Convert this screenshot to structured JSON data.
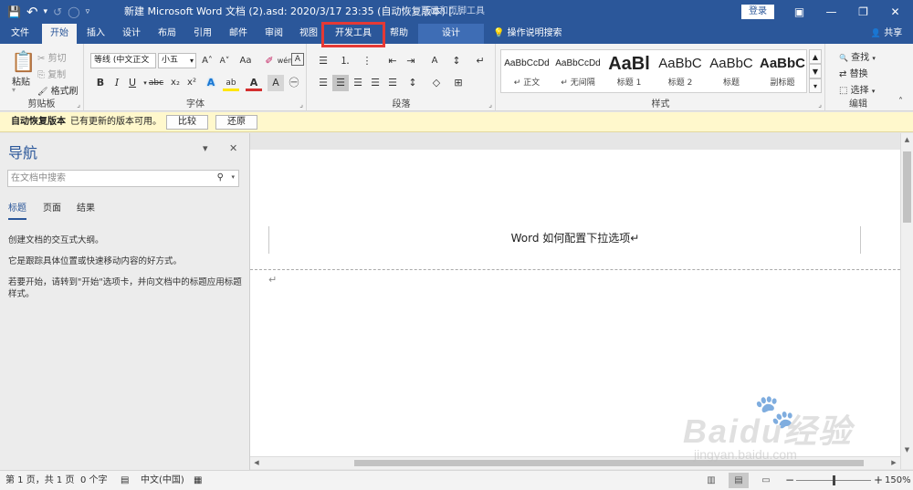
{
  "titlebar": {
    "save_icon": "💾",
    "undo_icon": "↶",
    "undo_dd": "▾",
    "redo_icon": "↺",
    "autosave_icon": "◯",
    "customize_icon": "▿",
    "title": "新建 Microsoft Word 文档 (2).asd: 2020/3/17 23:35 (自动恢复版本) [...",
    "context_group": "页眉和页脚工具",
    "login": "登录",
    "ribbon_display_icon": "▣",
    "minimize_icon": "—",
    "restore_icon": "❐",
    "close_icon": "✕"
  },
  "tabs": [
    {
      "label": "文件"
    },
    {
      "label": "开始"
    },
    {
      "label": "插入"
    },
    {
      "label": "设计"
    },
    {
      "label": "布局"
    },
    {
      "label": "引用"
    },
    {
      "label": "邮件"
    },
    {
      "label": "审阅"
    },
    {
      "label": "视图"
    },
    {
      "label": "开发工具"
    },
    {
      "label": "帮助"
    },
    {
      "label": "设计"
    }
  ],
  "tell_me": {
    "icon": "💡",
    "label": "操作说明搜索"
  },
  "share": {
    "icon": "👤",
    "label": "共享"
  },
  "ribbon": {
    "clipboard": {
      "label": "剪贴板",
      "paste": "粘贴",
      "paste_icon": "📋",
      "cut": "剪切",
      "cut_icon": "✂",
      "copy": "复制",
      "copy_icon": "⎘",
      "format_painter": "格式刷",
      "format_painter_icon": "🖌"
    },
    "font": {
      "label": "字体",
      "font_name": "等线 (中文正文",
      "font_size": "小五",
      "grow": "A˄",
      "shrink": "A˅",
      "case": "Aa",
      "clear": "✐",
      "phonetic": "wén",
      "border": "A",
      "bold": "B",
      "italic": "I",
      "underline": "U",
      "strike": "abc",
      "subscript": "x₂",
      "superscript": "x²",
      "effects": "A",
      "highlight": "ab",
      "font_color": "A",
      "shade": "A",
      "circled": "㊀"
    },
    "paragraph": {
      "label": "段落",
      "bullets": "☰",
      "numbering": "⒈",
      "multilevel": "⋮",
      "dec_indent": "⇤",
      "inc_indent": "⇥",
      "chinese_layout": "A",
      "sort": "↕",
      "show_marks": "↵",
      "align_left": "☰",
      "center": "☰",
      "align_right": "☰",
      "justify": "☰",
      "distributed": "☰",
      "line_spacing": "↕",
      "shading": "◇",
      "borders": "⊞"
    },
    "styles": {
      "label": "样式",
      "items": [
        {
          "preview": "AaBbCcDd",
          "name": "↵ 正文"
        },
        {
          "preview": "AaBbCcDd",
          "name": "↵ 无间隔"
        },
        {
          "preview": "AaBl",
          "name": "标题 1"
        },
        {
          "preview": "AaBbC",
          "name": "标题 2"
        },
        {
          "preview": "AaBbC",
          "name": "标题"
        },
        {
          "preview": "AaBbC",
          "name": "副标题"
        }
      ],
      "up": "▲",
      "down": "▼",
      "more": "▾"
    },
    "editing": {
      "label": "编辑",
      "find": "查找",
      "find_icon": "🔍",
      "replace": "替换",
      "replace_icon": "⇄",
      "select": "选择",
      "select_icon": "⬚"
    },
    "collapse_icon": "˄"
  },
  "message_bar": {
    "title": "自动恢复版本",
    "text": "已有更新的版本可用。",
    "compare": "比较",
    "restore": "还原"
  },
  "nav": {
    "title": "导航",
    "options_icon": "▾",
    "close_icon": "✕",
    "search_placeholder": "在文档中搜索",
    "search_icon": "⚲",
    "search_dd": "▾",
    "tabs": [
      "标题",
      "页面",
      "结果"
    ],
    "p1": "创建文档的交互式大纲。",
    "p2": "它是跟踪具体位置或快速移动内容的好方式。",
    "p3": "若要开始，请转到\"开始\"选项卡，并向文档中的标题应用标题样式。"
  },
  "document": {
    "header_text": "Word 如何配置下拉选项↵",
    "para_mark": "↵"
  },
  "scroll": {
    "up": "▲",
    "down": "▼",
    "left": "◀",
    "right": "▶"
  },
  "watermark": {
    "brand": "Baidu经验",
    "url": "jingyan.baidu.com",
    "paw": "🐾"
  },
  "status": {
    "page": "第 1 页，共 1 页",
    "words": "0 个字",
    "macro_icon": "▤",
    "language": "中文(中国)",
    "track_icon": "▦",
    "read_mode_icon": "▥",
    "print_layout_icon": "▤",
    "web_layout_icon": "▭",
    "zoom_out": "−",
    "zoom_in": "+",
    "zoom": "150%"
  },
  "colors": {
    "word_blue": "#2b579a",
    "highlight_red": "#e53935",
    "font_red": "#d32f2f",
    "highlight_yellow": "#ffe600"
  }
}
